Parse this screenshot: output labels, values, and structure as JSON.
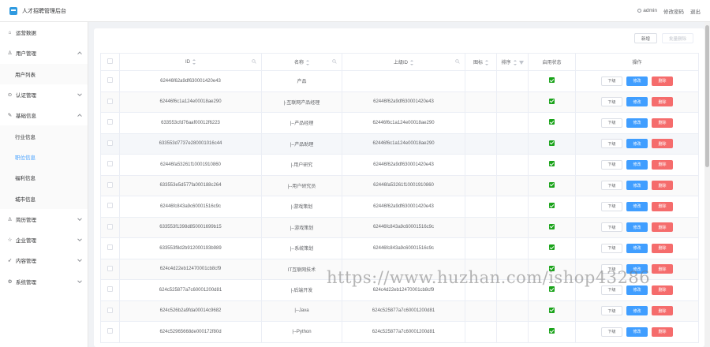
{
  "header": {
    "app_title": "人才招聘管理后台",
    "user": "admin",
    "change_password": "修改密码",
    "logout": "退出"
  },
  "sidebar": {
    "items": [
      {
        "label": "运营数据",
        "icon": "home-icon"
      },
      {
        "label": "用户管理",
        "icon": "user-icon",
        "expanded": true,
        "children": [
          "用户列表"
        ]
      },
      {
        "label": "认证管理",
        "icon": "verify-icon"
      },
      {
        "label": "基础信息",
        "icon": "edit-icon",
        "expanded": true,
        "children": [
          "行业信息",
          "职位信息",
          "福利信息",
          "城市信息"
        ]
      },
      {
        "label": "简历管理",
        "icon": "resume-icon"
      },
      {
        "label": "企业管理",
        "icon": "star-icon"
      },
      {
        "label": "内容管理",
        "icon": "send-icon"
      },
      {
        "label": "系统管理",
        "icon": "gear-icon"
      }
    ],
    "active_sub": "职位信息"
  },
  "toolbar": {
    "add_label": "新增",
    "batch_delete_label": "批量删除"
  },
  "table": {
    "headers": {
      "id": "ID",
      "name": "名称",
      "parent_id": "上级ID",
      "icon": "图标",
      "sort": "排序",
      "status": "启用状态",
      "ops": "操作"
    },
    "row_actions": {
      "child": "下级",
      "edit": "修改",
      "delete": "删除"
    },
    "rows": [
      {
        "id": "62446f62a9df630001420e43",
        "name": "产品",
        "parent_id": ""
      },
      {
        "id": "62446f6c1a124e00018ae290",
        "name": "|-互联网产品经理",
        "parent_id": "62446f62a9df630001420e43"
      },
      {
        "id": "633553cfd76aaf00012f6223",
        "name": "|--产品经理",
        "parent_id": "62446f6c1a124e00018ae290"
      },
      {
        "id": "633553d7737e280001016c44",
        "name": "|--产品助理",
        "parent_id": "62446f6c1a124e00018ae290"
      },
      {
        "id": "62446fa53261f10001910860",
        "name": "|-用户研究",
        "parent_id": "62446f62a9df630001420e43"
      },
      {
        "id": "633553e5d577fa000188c264",
        "name": "|--用户研究员",
        "parent_id": "62446fa53261f10001910860"
      },
      {
        "id": "62446fc843a9c60001516c9c",
        "name": "|-游戏策划",
        "parent_id": "62446f62a9df630001420e43"
      },
      {
        "id": "633553f1398d850001699b15",
        "name": "|--游戏策划",
        "parent_id": "62446fc843a9c60001516c9c"
      },
      {
        "id": "633553f8d2b912000193b989",
        "name": "|--系统策划",
        "parent_id": "62446fc843a9c60001516c9c"
      },
      {
        "id": "624c4d22eb12470001cb8cf9",
        "name": "IT互联网技术",
        "parent_id": ""
      },
      {
        "id": "624c525877a7c60001200d81",
        "name": "|-后端开发",
        "parent_id": "624c4d22eb12470001cb8cf9"
      },
      {
        "id": "624c526b2a9fda00014c9682",
        "name": "|--Java",
        "parent_id": "624c525877a7c60001200d81"
      },
      {
        "id": "624c52965668de000172f80d",
        "name": "|--Python",
        "parent_id": "624c525877a7c60001200d81"
      }
    ]
  },
  "watermark": "https://www.huzhan.com/ishop43286",
  "colors": {
    "primary": "#409eff",
    "danger": "#f56c6c",
    "status_green": "#1aa31a"
  }
}
